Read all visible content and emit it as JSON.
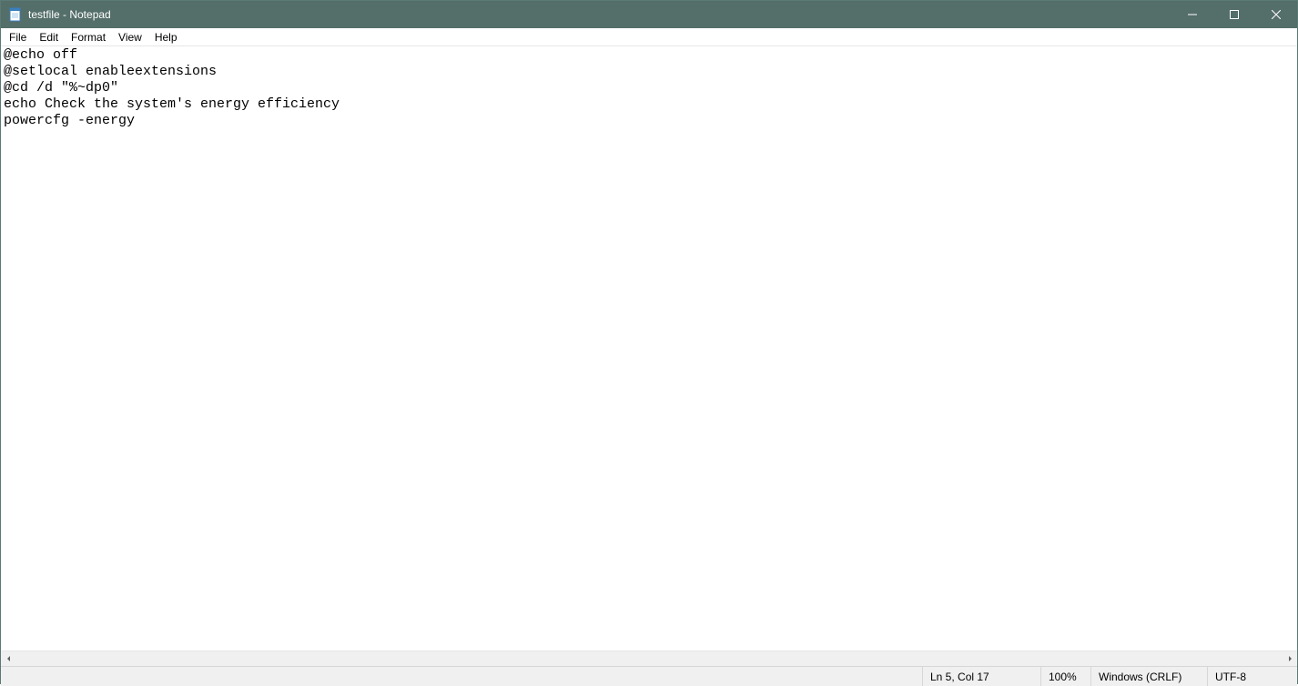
{
  "titlebar": {
    "title": "testfile - Notepad"
  },
  "menubar": {
    "items": [
      "File",
      "Edit",
      "Format",
      "View",
      "Help"
    ]
  },
  "editor": {
    "content": "@echo off\n@setlocal enableextensions\n@cd /d \"%~dp0\"\necho Check the system's energy efficiency\npowercfg -energy"
  },
  "statusbar": {
    "linecol": "Ln 5, Col 17",
    "zoom": "100%",
    "lineend": "Windows (CRLF)",
    "encoding": "UTF-8"
  }
}
